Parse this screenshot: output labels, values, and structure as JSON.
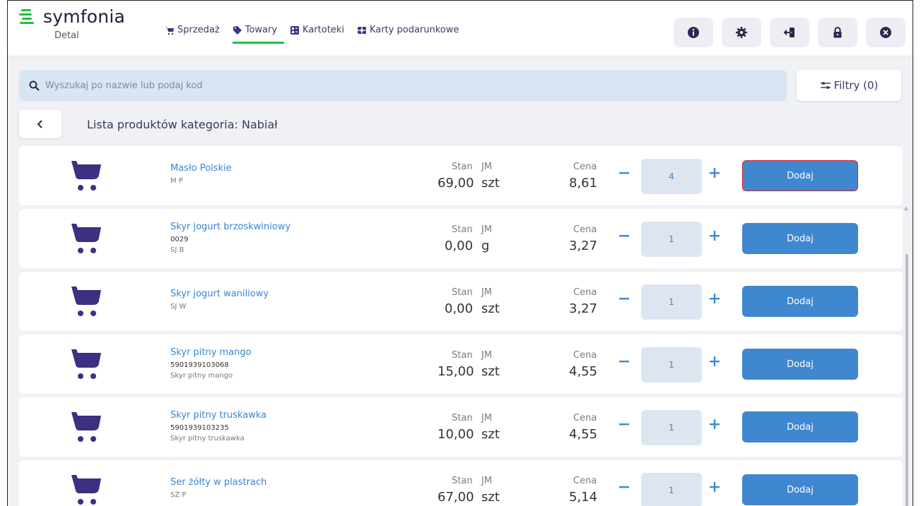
{
  "app": {
    "logo_text": "symfonia",
    "logo_sub": "Detal",
    "brand_color": "#20c040",
    "accent_color": "#3f87cf"
  },
  "nav": [
    {
      "label": "Sprzedaż",
      "icon": "cart-icon",
      "active": false
    },
    {
      "label": "Towary",
      "icon": "tag-icon",
      "active": true
    },
    {
      "label": "Kartoteki",
      "icon": "cards-icon",
      "active": false
    },
    {
      "label": "Karty podarunkowe",
      "icon": "gift-card-icon",
      "active": false
    }
  ],
  "toolbar": {
    "buttons": [
      "info-icon",
      "settings-gear-icon",
      "logout-icon",
      "lock-icon",
      "close-icon"
    ]
  },
  "search": {
    "placeholder": "Wyszukaj po nazwie lub podaj kod"
  },
  "filter": {
    "label": "Filtry (0)"
  },
  "list": {
    "title": "Lista produktów kategoria: Nabiał",
    "stan_label": "Stan",
    "jm_label": "JM",
    "cena_label": "Cena",
    "add_label": "Dodaj",
    "items": [
      {
        "name": "Masło Polskie",
        "code": "",
        "sub": "M P",
        "stan": "69,00",
        "jm": "szt",
        "cena": "8,61",
        "qty": "4",
        "highlighted": true
      },
      {
        "name": "Skyr jogurt brzoskwiniowy",
        "code": "0029",
        "sub": "SJ B",
        "stan": "0,00",
        "jm": "g",
        "cena": "3,27",
        "qty": "1",
        "highlighted": false
      },
      {
        "name": "Skyr jogurt waniliowy",
        "code": "",
        "sub": "SJ W",
        "stan": "0,00",
        "jm": "szt",
        "cena": "3,27",
        "qty": "1",
        "highlighted": false
      },
      {
        "name": "Skyr pitny mango",
        "code": "5901939103068",
        "sub": "Skyr pitny mango",
        "stan": "15,00",
        "jm": "szt",
        "cena": "4,55",
        "qty": "1",
        "highlighted": false
      },
      {
        "name": "Skyr pitny truskawka",
        "code": "5901939103235",
        "sub": "Skyr pitny truskawka",
        "stan": "10,00",
        "jm": "szt",
        "cena": "4,55",
        "qty": "1",
        "highlighted": false
      },
      {
        "name": "Ser żółty w plastrach",
        "code": "",
        "sub": "SZ P",
        "stan": "67,00",
        "jm": "szt",
        "cena": "5,14",
        "qty": "1",
        "highlighted": false
      }
    ]
  }
}
